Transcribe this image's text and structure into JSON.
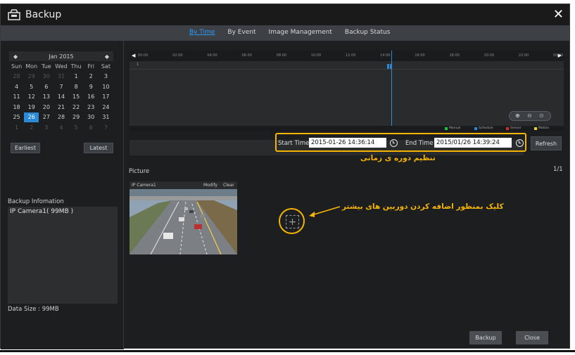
{
  "window": {
    "title": "Backup"
  },
  "tabs": [
    {
      "label": "By Time",
      "active": true
    },
    {
      "label": "By Event",
      "active": false
    },
    {
      "label": "Image Management",
      "active": false
    },
    {
      "label": "Backup Status",
      "active": false
    }
  ],
  "calendar": {
    "month_label": "Jan  2015",
    "weekdays": [
      "Sun",
      "Mon",
      "Tue",
      "Wed",
      "Thu",
      "Fri",
      "Sat"
    ],
    "weeks": [
      [
        {
          "d": "28",
          "o": true
        },
        {
          "d": "29",
          "o": true
        },
        {
          "d": "30",
          "o": true
        },
        {
          "d": "31",
          "o": true
        },
        {
          "d": "1"
        },
        {
          "d": "2"
        },
        {
          "d": "3"
        }
      ],
      [
        {
          "d": "4"
        },
        {
          "d": "5"
        },
        {
          "d": "6"
        },
        {
          "d": "7"
        },
        {
          "d": "8"
        },
        {
          "d": "9"
        },
        {
          "d": "10"
        }
      ],
      [
        {
          "d": "11"
        },
        {
          "d": "12"
        },
        {
          "d": "13"
        },
        {
          "d": "14"
        },
        {
          "d": "15"
        },
        {
          "d": "16"
        },
        {
          "d": "17"
        }
      ],
      [
        {
          "d": "18"
        },
        {
          "d": "19"
        },
        {
          "d": "20"
        },
        {
          "d": "21"
        },
        {
          "d": "22"
        },
        {
          "d": "23"
        },
        {
          "d": "24"
        }
      ],
      [
        {
          "d": "25"
        },
        {
          "d": "26",
          "sel": true
        },
        {
          "d": "27"
        },
        {
          "d": "28"
        },
        {
          "d": "29"
        },
        {
          "d": "30"
        },
        {
          "d": "31"
        }
      ],
      [
        {
          "d": "1",
          "o": true
        },
        {
          "d": "2",
          "o": true
        },
        {
          "d": "3",
          "o": true
        },
        {
          "d": "4",
          "o": true
        },
        {
          "d": "5",
          "o": true
        },
        {
          "d": "6",
          "o": true
        },
        {
          "d": "7",
          "o": true
        }
      ]
    ],
    "earliest_label": "Earliest",
    "latest_label": "Latest"
  },
  "backup_info": {
    "label": "Backup Infomation",
    "items": [
      "IP Camera1( 99MB )"
    ],
    "data_size": "Data Size : 99MB"
  },
  "timeline": {
    "ticks": [
      "00:00",
      "02:00",
      "04:00",
      "06:00",
      "08:00",
      "10:00",
      "12:00",
      "14:00",
      "16:00",
      "18:00",
      "20:00",
      "22:00",
      "00:00"
    ],
    "channel": "1",
    "legend": [
      {
        "label": "Manual",
        "color": "#22c23a"
      },
      {
        "label": "Schedule",
        "color": "#2b8ad6"
      },
      {
        "label": "Sensor",
        "color": "#d62b2b"
      },
      {
        "label": "Motion",
        "color": "#e8d22b"
      }
    ]
  },
  "time_range": {
    "start_label": "Start Time",
    "start_value": "2015-01-26 14:36:14",
    "end_label": "End Time",
    "end_value": "2015/01/26 14:39:24",
    "refresh_label": "Refresh",
    "annotation": "تنظیم دوره ی زمانی"
  },
  "picture": {
    "label": "Picture",
    "page": "1/1",
    "camera_name": "IP Camera1",
    "modify_label": "Modify",
    "clear_label": "Clear",
    "add_annotation": "کلیک بمنظور اضافه کردن دوربین های بیشتر"
  },
  "footer": {
    "backup_label": "Backup",
    "close_label": "Close"
  },
  "colors": {
    "accent": "#2b8ad6",
    "annotation": "#f4b400"
  }
}
